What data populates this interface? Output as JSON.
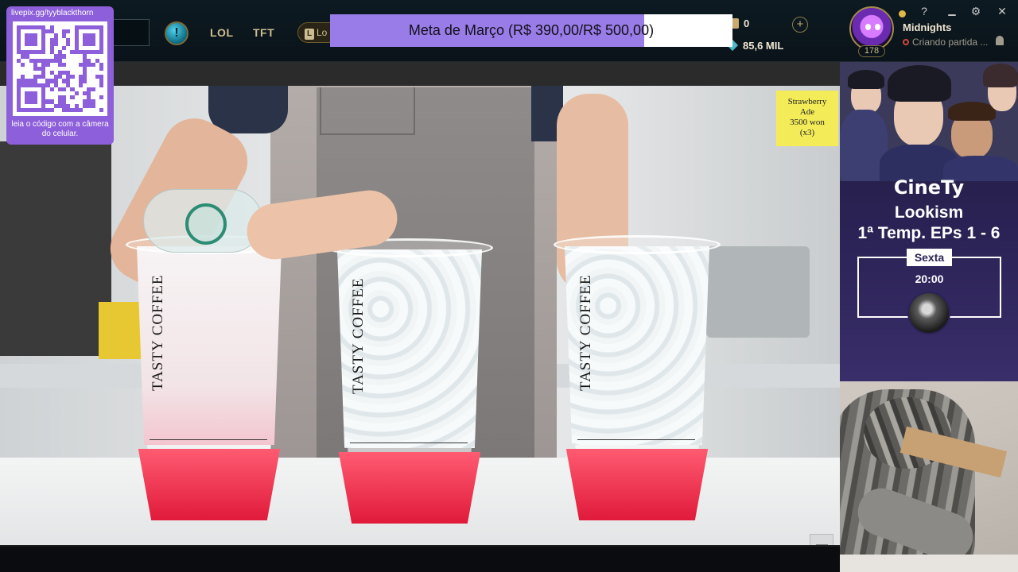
{
  "client": {
    "nav": [
      "LOL",
      "TFT"
    ],
    "loot_chip_label": "Lo",
    "riot_points": "0",
    "blue_essence": "85,6 MIL",
    "plus_label": "+",
    "profile": {
      "level": "178",
      "name": "Midnights",
      "status": "Criando partida ...",
      "status_color": "#e0b84a"
    },
    "window_buttons": [
      "?",
      "⚙",
      "✕"
    ],
    "help_label": "!"
  },
  "goal": {
    "label": "Meta de Março (R$ 390,00/R$ 500,00)",
    "current": 390,
    "target": 500,
    "fill_color": "#9a7ce8"
  },
  "qr": {
    "url": "livepix.gg/tyyblackthorn",
    "caption": "leia o código com a câmera do celular.",
    "card_color": "#8e5fda"
  },
  "video": {
    "price_note": [
      "Strawberry",
      "Ade",
      "3500 won",
      "(x3)"
    ],
    "cup_brand": "TASTY COFFEE"
  },
  "schedule": {
    "brand": "CineTy",
    "show": "Lookism",
    "season": "1ª Temp. EPs 1 - 6",
    "day": "Sexta",
    "time": "20:00"
  }
}
